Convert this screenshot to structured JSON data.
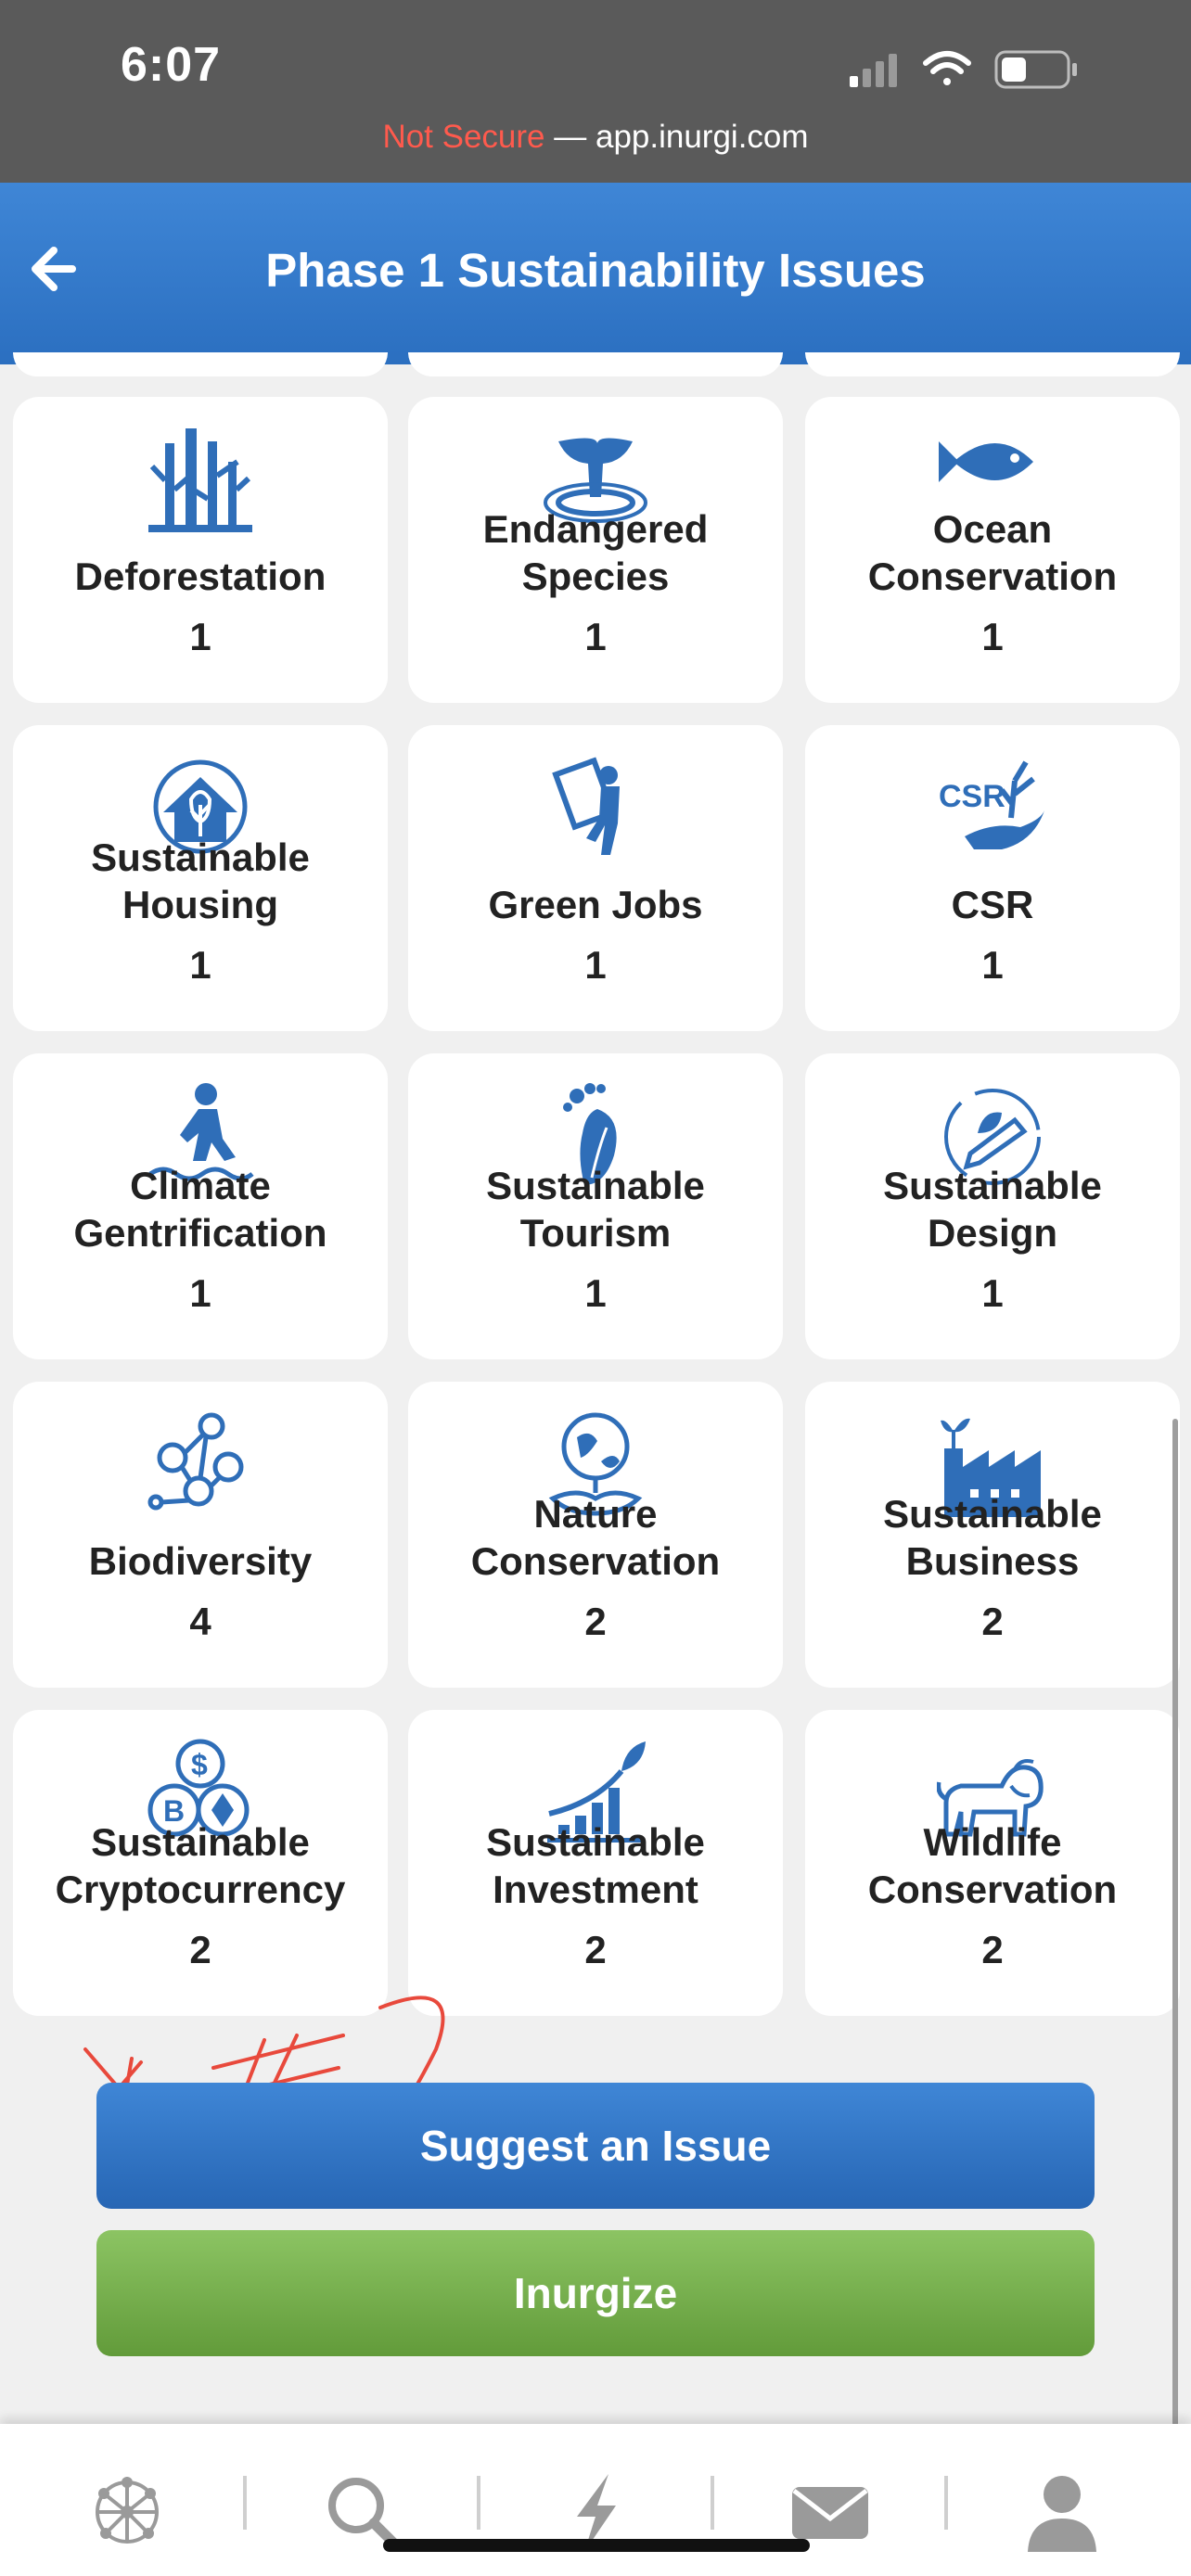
{
  "status": {
    "time": "6:07",
    "url_insecure": "Not Secure",
    "url_sep": " — ",
    "url_host": "app.inurgi.com"
  },
  "header": {
    "title": "Phase 1 Sustainability Issues",
    "back_icon": "back-arrow-icon"
  },
  "issues": [
    {
      "name": "Deforestation",
      "count": "1",
      "icon": "deforestation-icon"
    },
    {
      "name": "Endangered\nSpecies",
      "count": "1",
      "icon": "whale-tail-icon"
    },
    {
      "name": "Ocean\nConservation",
      "count": "1",
      "icon": "fish-icon"
    },
    {
      "name": "Sustainable\nHousing",
      "count": "1",
      "icon": "eco-house-icon"
    },
    {
      "name": "Green Jobs",
      "count": "1",
      "icon": "worker-panel-icon"
    },
    {
      "name": "CSR",
      "count": "1",
      "icon": "csr-hand-plant-icon"
    },
    {
      "name": "Climate\nGentrification",
      "count": "1",
      "icon": "person-walking-water-icon"
    },
    {
      "name": "Sustainable\nTourism",
      "count": "1",
      "icon": "footprint-leaf-icon"
    },
    {
      "name": "Sustainable\nDesign",
      "count": "1",
      "icon": "pencil-leaf-icon"
    },
    {
      "name": "Biodiversity",
      "count": "4",
      "icon": "biodiversity-network-icon"
    },
    {
      "name": "Nature\nConservation",
      "count": "2",
      "icon": "globe-hand-icon"
    },
    {
      "name": "Sustainable\nBusiness",
      "count": "2",
      "icon": "factory-sprout-icon"
    },
    {
      "name": "Sustainable\nCryptocurrency",
      "count": "2",
      "icon": "crypto-coins-icon"
    },
    {
      "name": "Sustainable\nInvestment",
      "count": "2",
      "icon": "growth-chart-icon"
    },
    {
      "name": "Wildlife\nConservation",
      "count": "2",
      "icon": "lion-icon"
    }
  ],
  "buttons": {
    "suggest": "Suggest an Issue",
    "inurgize": "Inurgize"
  },
  "annotation": "#2",
  "colors": {
    "brand_blue": "#2f74c8",
    "brand_green": "#78b04e",
    "icon_blue": "#2f6eb8",
    "annotation_red": "#e8493c"
  },
  "nav": [
    "network-icon",
    "search-icon",
    "lightning-icon",
    "mail-icon",
    "profile-icon"
  ]
}
